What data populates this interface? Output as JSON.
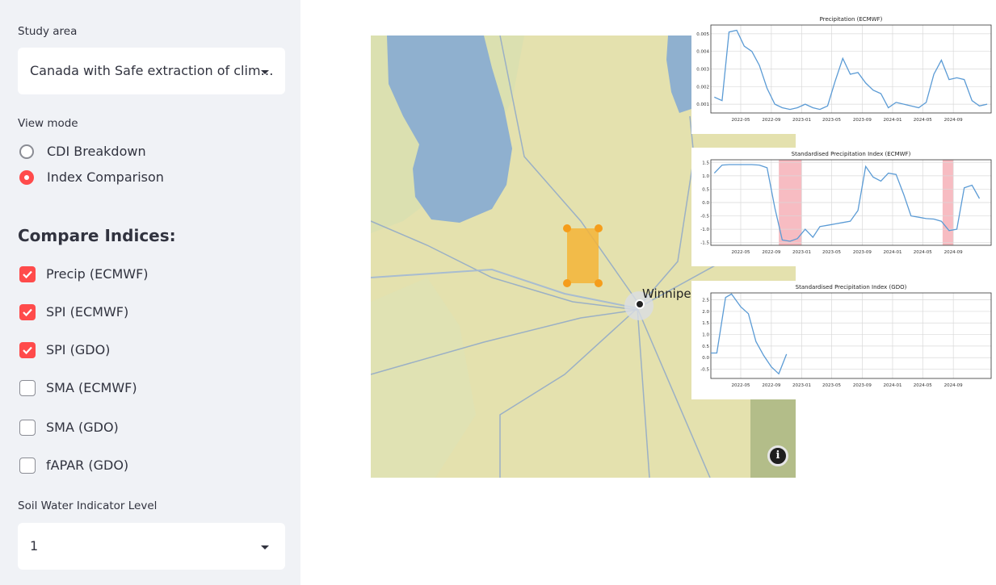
{
  "sidebar": {
    "study_area": {
      "label": "Study area",
      "value": "Canada with Safe extraction of clim…"
    },
    "view_mode": {
      "label": "View mode",
      "options": [
        {
          "label": "CDI Breakdown",
          "selected": false
        },
        {
          "label": "Index Comparison",
          "selected": true
        }
      ]
    },
    "compare_heading": "Compare Indices:",
    "indices": [
      {
        "label": "Precip (ECMWF)",
        "checked": true
      },
      {
        "label": "SPI (ECMWF)",
        "checked": true
      },
      {
        "label": "SPI (GDO)",
        "checked": true
      },
      {
        "label": "SMA (ECMWF)",
        "checked": false
      },
      {
        "label": "SMA (GDO)",
        "checked": false
      },
      {
        "label": "fAPAR (GDO)",
        "checked": false
      }
    ],
    "soil_level": {
      "label": "Soil Water Indicator Level",
      "value": "1"
    }
  },
  "map": {
    "city_label": "Winnipeg",
    "info_icon": "i",
    "colors": {
      "land": "#e6e2ae",
      "water": "#8fb0cf",
      "selection": "#f4b437",
      "handle": "#f59d1b"
    }
  },
  "chart_data": [
    {
      "type": "line",
      "title": "Precipitation (ECMWF)",
      "xticks": [
        "2022-05",
        "2022-09",
        "2023-01",
        "2023-05",
        "2023-09",
        "2024-01",
        "2024-05",
        "2024-09"
      ],
      "yticks": [
        "0.001",
        "0.002",
        "0.003",
        "0.004",
        "0.005"
      ],
      "ylim": [
        0.0005,
        0.0055
      ],
      "series": [
        {
          "color": "#5b9bd5",
          "points": [
            [
              "2022-01-15",
              0.0014
            ],
            [
              "2022-02-15",
              0.0012
            ],
            [
              "2022-03-15",
              0.0051
            ],
            [
              "2022-04-15",
              0.0052
            ],
            [
              "2022-05-15",
              0.0043
            ],
            [
              "2022-06-15",
              0.004
            ],
            [
              "2022-07-15",
              0.0032
            ],
            [
              "2022-08-15",
              0.0019
            ],
            [
              "2022-09-15",
              0.001
            ],
            [
              "2022-10-15",
              0.0008
            ],
            [
              "2022-11-15",
              0.0007
            ],
            [
              "2022-12-15",
              0.0008
            ],
            [
              "2023-01-15",
              0.001
            ],
            [
              "2023-02-15",
              0.0008
            ],
            [
              "2023-03-15",
              0.0007
            ],
            [
              "2023-04-15",
              0.0009
            ],
            [
              "2023-05-15",
              0.0023
            ],
            [
              "2023-06-15",
              0.0036
            ],
            [
              "2023-07-15",
              0.0027
            ],
            [
              "2023-08-15",
              0.0028
            ],
            [
              "2023-09-15",
              0.0022
            ],
            [
              "2023-10-15",
              0.0018
            ],
            [
              "2023-11-15",
              0.0016
            ],
            [
              "2023-12-15",
              0.0008
            ],
            [
              "2024-01-15",
              0.0011
            ],
            [
              "2024-02-15",
              0.001
            ],
            [
              "2024-03-15",
              0.0009
            ],
            [
              "2024-04-15",
              0.0008
            ],
            [
              "2024-05-15",
              0.0011
            ],
            [
              "2024-06-15",
              0.0027
            ],
            [
              "2024-07-15",
              0.0035
            ],
            [
              "2024-08-15",
              0.0024
            ],
            [
              "2024-09-15",
              0.0025
            ],
            [
              "2024-10-15",
              0.0024
            ],
            [
              "2024-11-15",
              0.0012
            ],
            [
              "2024-12-15",
              0.0009
            ],
            [
              "2025-01-15",
              0.001
            ]
          ]
        }
      ],
      "shaded_spans": []
    },
    {
      "type": "line",
      "title": "Standardised Precipitation Index (ECMWF)",
      "xticks": [
        "2022-05",
        "2022-09",
        "2023-01",
        "2023-05",
        "2023-09",
        "2024-01",
        "2024-05",
        "2024-09"
      ],
      "yticks": [
        "-1.5",
        "-1.0",
        "-0.5",
        "0.0",
        "0.5",
        "1.0",
        "1.5"
      ],
      "ylim": [
        -1.6,
        1.6
      ],
      "series": [
        {
          "color": "#5b9bd5",
          "points": [
            [
              "2022-01-15",
              1.1
            ],
            [
              "2022-02-15",
              1.4
            ],
            [
              "2022-03-15",
              1.42
            ],
            [
              "2022-04-15",
              1.42
            ],
            [
              "2022-05-15",
              1.42
            ],
            [
              "2022-06-15",
              1.42
            ],
            [
              "2022-07-15",
              1.4
            ],
            [
              "2022-08-15",
              1.3
            ],
            [
              "2022-09-15",
              -0.2
            ],
            [
              "2022-10-15",
              -1.4
            ],
            [
              "2022-11-15",
              -1.45
            ],
            [
              "2022-12-15",
              -1.35
            ],
            [
              "2023-01-15",
              -1.0
            ],
            [
              "2023-02-15",
              -1.3
            ],
            [
              "2023-03-15",
              -0.9
            ],
            [
              "2023-04-15",
              -0.85
            ],
            [
              "2023-05-15",
              -0.8
            ],
            [
              "2023-06-15",
              -0.75
            ],
            [
              "2023-07-15",
              -0.7
            ],
            [
              "2023-08-15",
              -0.3
            ],
            [
              "2023-09-15",
              1.35
            ],
            [
              "2023-10-15",
              0.95
            ],
            [
              "2023-11-15",
              0.8
            ],
            [
              "2023-12-15",
              1.1
            ],
            [
              "2024-01-15",
              1.05
            ],
            [
              "2024-02-15",
              0.3
            ],
            [
              "2024-03-15",
              -0.5
            ],
            [
              "2024-04-15",
              -0.55
            ],
            [
              "2024-05-15",
              -0.6
            ],
            [
              "2024-06-15",
              -0.62
            ],
            [
              "2024-07-15",
              -0.7
            ],
            [
              "2024-08-15",
              -1.05
            ],
            [
              "2024-09-15",
              -1.0
            ],
            [
              "2024-10-15",
              0.55
            ],
            [
              "2024-11-15",
              0.65
            ],
            [
              "2024-12-15",
              0.15
            ]
          ]
        }
      ],
      "shaded_spans": [
        [
          "2022-10-01",
          "2022-12-31"
        ],
        [
          "2024-07-20",
          "2024-09-01"
        ]
      ],
      "shade_color": "#f4a6ae"
    },
    {
      "type": "line",
      "title": "Standardised Precipitation Index (GDO)",
      "xticks": [
        "2022-05",
        "2022-09",
        "2023-01",
        "2023-05",
        "2023-09",
        "2024-01",
        "2024-05",
        "2024-09"
      ],
      "yticks": [
        "-0.5",
        "0.0",
        "0.5",
        "1.0",
        "1.5",
        "2.0",
        "2.5"
      ],
      "ylim": [
        -0.9,
        2.8
      ],
      "series": [
        {
          "color": "#5b9bd5",
          "points": [
            [
              "2022-01-01",
              0.2
            ],
            [
              "2022-01-25",
              0.2
            ],
            [
              "2022-03-01",
              2.6
            ],
            [
              "2022-03-25",
              2.75
            ],
            [
              "2022-05-01",
              2.2
            ],
            [
              "2022-06-01",
              1.9
            ],
            [
              "2022-07-01",
              0.7
            ],
            [
              "2022-08-01",
              0.1
            ],
            [
              "2022-09-01",
              -0.4
            ],
            [
              "2022-10-01",
              -0.7
            ],
            [
              "2022-11-01",
              0.15
            ]
          ]
        }
      ],
      "shaded_spans": []
    }
  ]
}
